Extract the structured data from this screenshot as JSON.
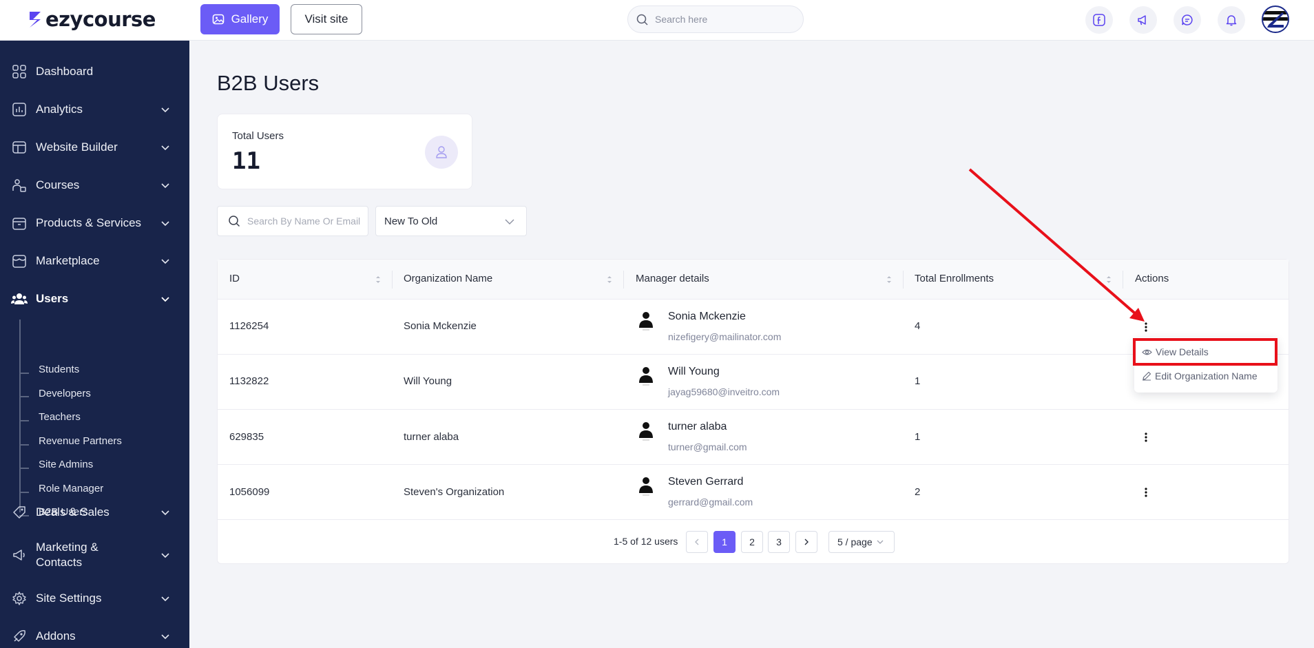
{
  "brand": {
    "name": "ezycourse",
    "color": "#5a43f0"
  },
  "header": {
    "gallery_label": "Gallery",
    "visit_label": "Visit site",
    "search_placeholder": "Search here"
  },
  "sidebar": {
    "items": [
      {
        "label": "Dashboard",
        "icon": "dashboard-icon"
      },
      {
        "label": "Analytics",
        "icon": "analytics-icon"
      },
      {
        "label": "Website Builder",
        "icon": "website-builder-icon"
      },
      {
        "label": "Courses",
        "icon": "courses-icon"
      },
      {
        "label": "Products & Services",
        "icon": "products-icon"
      },
      {
        "label": "Marketplace",
        "icon": "marketplace-icon"
      },
      {
        "label": "Users",
        "icon": "users-icon"
      },
      {
        "label": "Deals & Sales",
        "icon": "deals-icon"
      },
      {
        "label": "Marketing &",
        "label2": "Contacts",
        "icon": "marketing-icon"
      },
      {
        "label": "Site Settings",
        "icon": "settings-icon"
      },
      {
        "label": "Addons",
        "icon": "addons-icon"
      }
    ],
    "users_sub": [
      "Students",
      "Developers",
      "Teachers",
      "Revenue Partners",
      "Site Admins",
      "Role Manager",
      "B2B Users"
    ]
  },
  "main": {
    "title": "B2B Users",
    "stat": {
      "label": "Total Users",
      "value": "11"
    },
    "search_placeholder": "Search By Name Or Email",
    "sort_value": "New To Old",
    "columns": [
      "ID",
      "Organization Name",
      "Manager details",
      "Total Enrollments",
      "Actions"
    ],
    "rows": [
      {
        "id": "1126254",
        "org": "Sonia Mckenzie",
        "manager_name": "Sonia Mckenzie",
        "manager_email": "nizefigery@mailinator.com",
        "enrollments": "4"
      },
      {
        "id": "1132822",
        "org": "Will Young",
        "manager_name": "Will Young",
        "manager_email": "jayag59680@inveitro.com",
        "enrollments": "1"
      },
      {
        "id": "629835",
        "org": "turner alaba",
        "manager_name": "turner alaba",
        "manager_email": "turner@gmail.com",
        "enrollments": "1"
      },
      {
        "id": "1056099",
        "org": "Steven's Organization",
        "manager_name": "Steven Gerrard",
        "manager_email": "gerrard@gmail.com",
        "enrollments": "2"
      }
    ],
    "pagination": {
      "summary": "1-5 of 12 users",
      "pages": [
        "1",
        "2",
        "3"
      ],
      "active": "1",
      "page_size": "5 / page"
    },
    "actions_menu": {
      "view": "View Details",
      "edit": "Edit Organization Name"
    }
  },
  "annotation_color": "#e8101a"
}
